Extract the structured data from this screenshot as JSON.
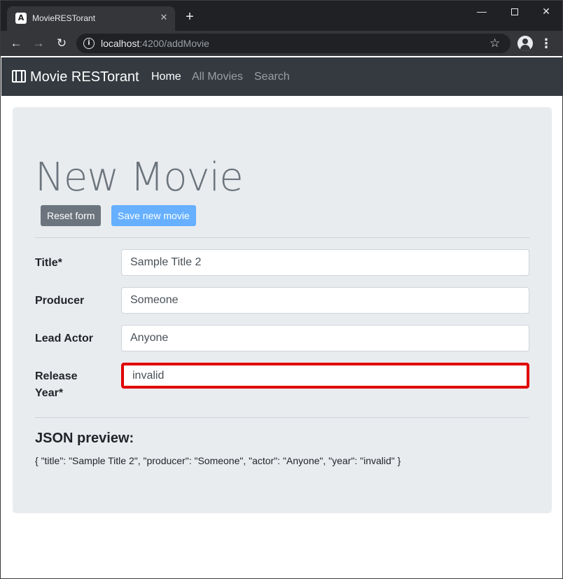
{
  "browser": {
    "tab_title": "MovieRESTorant",
    "tab_favicon_letter": "A",
    "url_host": "localhost",
    "url_rest": ":4200/addMovie"
  },
  "navbar": {
    "brand": "Movie RESTorant",
    "links": [
      {
        "label": "Home",
        "active": true
      },
      {
        "label": "All Movies",
        "active": false
      },
      {
        "label": "Search",
        "active": false
      }
    ]
  },
  "page": {
    "title": "New Movie",
    "buttons": {
      "reset": "Reset form",
      "save": "Save new movie"
    },
    "fields": [
      {
        "label": "Title*",
        "value": "Sample Title 2"
      },
      {
        "label": "Producer",
        "value": "Someone"
      },
      {
        "label": "Lead Actor",
        "value": "Anyone"
      },
      {
        "label": "Release Year*",
        "value": "invalid",
        "invalid": true
      }
    ],
    "json_heading": "JSON preview:",
    "json_preview": "{ \"title\": \"Sample Title 2\", \"producer\": \"Someone\", \"actor\": \"Anyone\", \"year\": \"invalid\" }"
  },
  "colors": {
    "navbar_bg": "#343a40",
    "jumbotron_bg": "#e9ecef",
    "reset_button": "#6c757d",
    "save_button": "#66b0ff",
    "invalid_border": "#e00000"
  },
  "icons": [
    "angular-favicon",
    "close-icon",
    "plus-icon",
    "back-arrow-icon",
    "forward-arrow-icon",
    "reload-icon",
    "info-icon",
    "star-icon",
    "profile-icon",
    "kebab-menu-icon",
    "film-icon"
  ]
}
